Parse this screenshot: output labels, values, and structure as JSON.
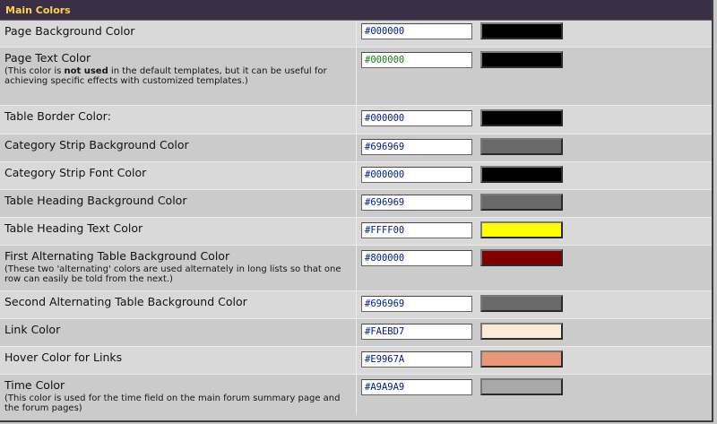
{
  "header": {
    "title": "Main Colors"
  },
  "rows": [
    {
      "label": "Page Background Color",
      "value": "#000000",
      "swatch": "#000000"
    },
    {
      "label": "Page Text Color",
      "note_pre": "(This color is ",
      "note_bold": "not used",
      "note_post": " in the default templates, but it can be useful for achieving specific effects with customized templates.)",
      "value": "#000000",
      "swatch": "#000000"
    },
    {
      "label": "Table Border Color:",
      "value": "#000000",
      "swatch": "#000000"
    },
    {
      "label": "Category Strip Background Color",
      "value": "#696969",
      "swatch": "#696969"
    },
    {
      "label": "Category Strip Font Color",
      "value": "#000000",
      "swatch": "#000000"
    },
    {
      "label": "Table Heading Background Color",
      "value": "#696969",
      "swatch": "#696969"
    },
    {
      "label": "Table Heading Text Color",
      "value": "#FFFF00",
      "swatch": "#FFFF00"
    },
    {
      "label": "First Alternating Table Background Color",
      "note": "(These two 'alternating' colors are used alternately in long lists so that one row can easily be told from the next.)",
      "value": "#800000",
      "swatch": "#800000"
    },
    {
      "label": "Second Alternating Table Background Color",
      "value": "#696969",
      "swatch": "#696969"
    },
    {
      "label": "Link Color",
      "value": "#FAEBD7",
      "swatch": "#FAEBD7"
    },
    {
      "label": "Hover Color for Links",
      "value": "#E9967A",
      "swatch": "#E9967A"
    },
    {
      "label": "Time Color",
      "note": "(This color is used for the time field on the main forum summary page and the forum pages)",
      "value": "#A9A9A9",
      "swatch": "#A9A9A9"
    }
  ],
  "colors": {
    "header_bg": "#3b2f45",
    "header_text": "#ffd24a",
    "hex_text": "#001a80",
    "hex_text_alt": "#1a7a1a"
  }
}
